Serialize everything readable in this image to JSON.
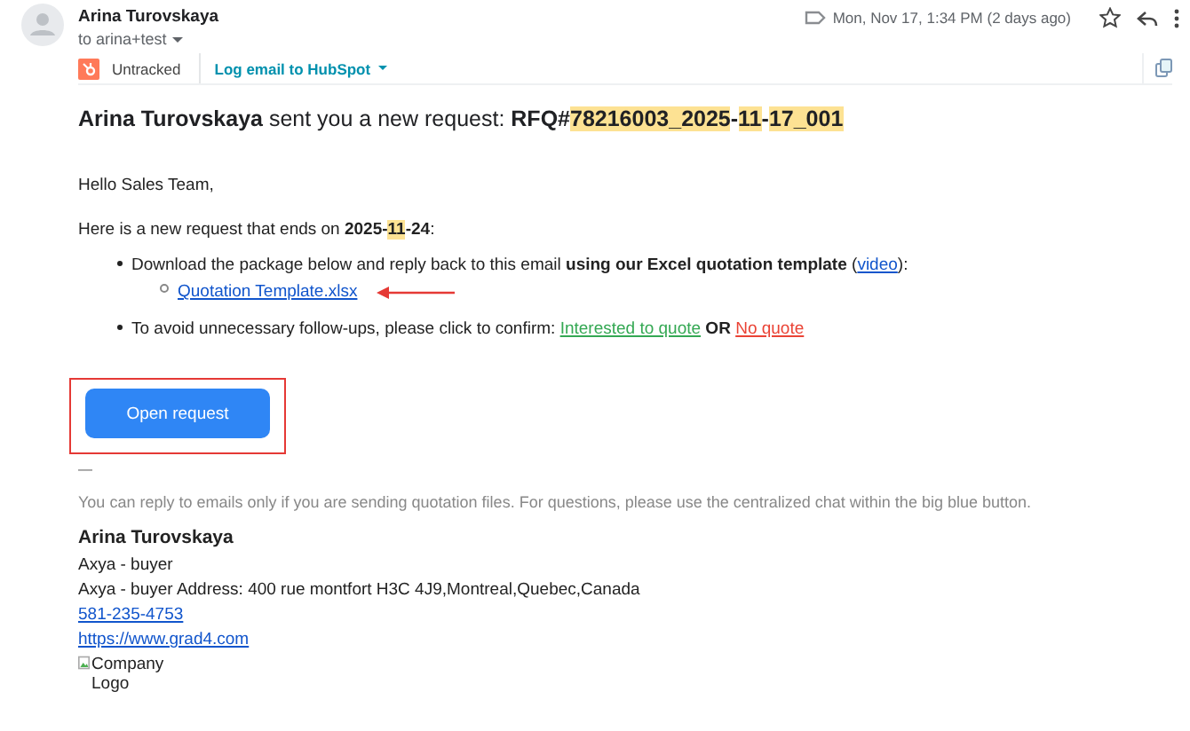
{
  "sender": {
    "name": "Arina Turovskaya",
    "recipient": "to arina+test"
  },
  "date": "Mon, Nov 17, 1:34 PM (2 days ago)",
  "starred": false,
  "hubspot": {
    "status": "Untracked",
    "action": "Log email to HubSpot"
  },
  "heading": [
    {
      "kind": "bold",
      "text": "Arina Turovskaya"
    },
    {
      "kind": "text",
      "text": " sent you a new request: "
    },
    {
      "kind": "bold",
      "text": "RFQ#"
    },
    {
      "kind": "mark",
      "text": "78216003_2025"
    },
    {
      "kind": "bold",
      "text": "-"
    },
    {
      "kind": "mark",
      "text": "11"
    },
    {
      "kind": "bold",
      "text": "-"
    },
    {
      "kind": "mark",
      "text": "17_001"
    }
  ],
  "greeting": "Hello Sales Team,",
  "intro": [
    {
      "kind": "text",
      "text": "Here is a new request that ends on "
    },
    {
      "kind": "bold",
      "text": "2025-"
    },
    {
      "kind": "mark",
      "text": "11"
    },
    {
      "kind": "bold",
      "text": "-24"
    },
    {
      "kind": "text",
      "text": ":"
    }
  ],
  "bullets": [
    {
      "segments": [
        {
          "kind": "text",
          "text": "Download the package below and reply back to this email "
        },
        {
          "kind": "bold",
          "text": "using our Excel quotation template"
        },
        {
          "kind": "text",
          "text": " ("
        },
        {
          "kind": "link",
          "text": "video",
          "color": "#1155cc"
        },
        {
          "kind": "text",
          "text": "):"
        }
      ],
      "children": [
        {
          "segments": [
            {
              "kind": "link",
              "text": "Quotation Template.xlsx",
              "color": "#1155cc"
            }
          ],
          "annotated": true
        }
      ]
    },
    {
      "segments": [
        {
          "kind": "text",
          "text": "To avoid unnecessary follow-ups, please click to confirm: "
        },
        {
          "kind": "link",
          "text": "Interested to quote",
          "color": "#34a853"
        },
        {
          "kind": "bold",
          "text": " OR "
        },
        {
          "kind": "link",
          "text": "No quote",
          "color": "#ea4335"
        }
      ]
    }
  ],
  "button": {
    "label": "Open request",
    "annotated": true
  },
  "separator": "—",
  "notice": "You can reply to emails only if you are sending quotation files. For questions, please use the centralized chat within the big blue button.",
  "signature": {
    "name": "Arina Turovskaya",
    "lines": [
      "Axya - buyer",
      "Axya - buyer Address: 400 rue montfort H3C 4J9,Montreal,Quebec,Canada"
    ],
    "phone": "581-235-4753",
    "website": "https://www.grad4.com",
    "logo_alt": "Company Logo"
  }
}
